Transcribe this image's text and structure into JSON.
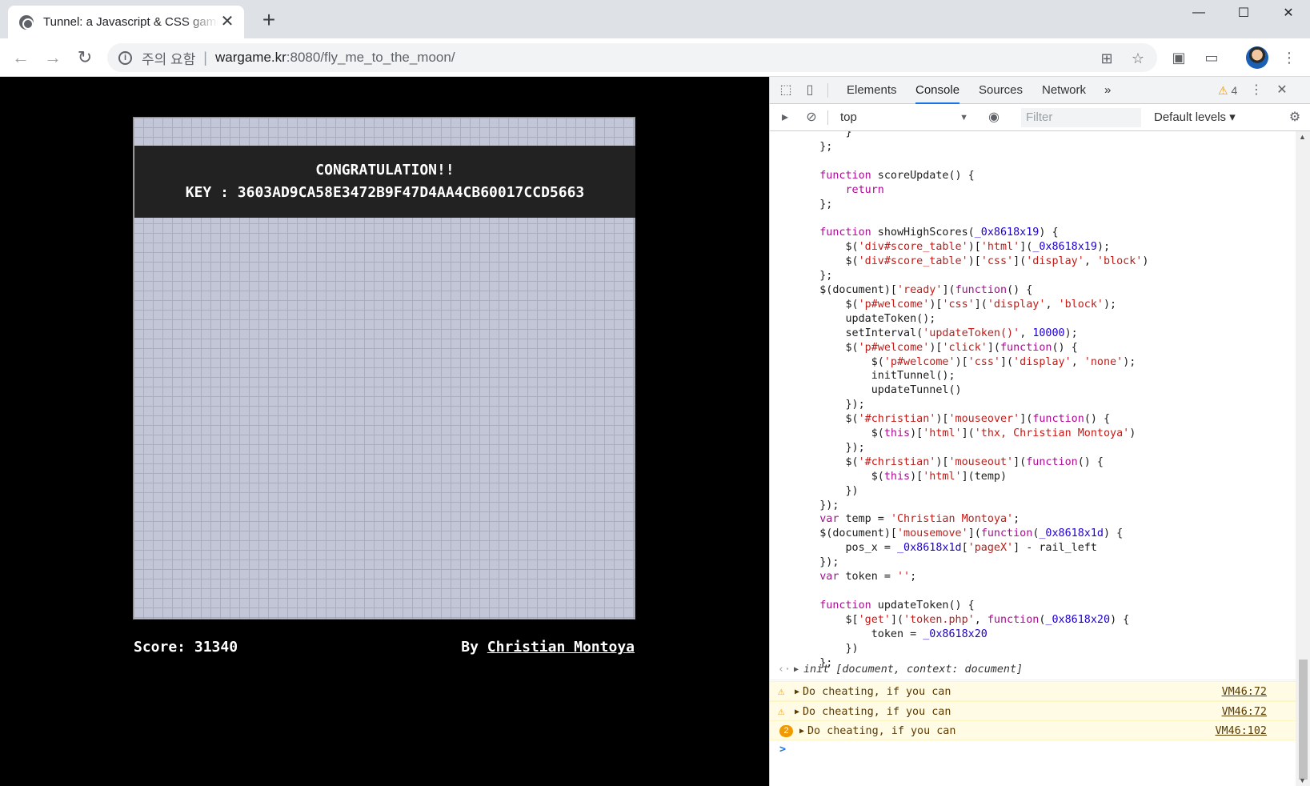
{
  "browser": {
    "tab_title": "Tunnel: a Javascript & CSS game",
    "tab_close": "✕",
    "new_tab": "+",
    "window_controls": {
      "minimize": "—",
      "maximize": "☐",
      "close": "✕"
    },
    "security_label": "주의 요함",
    "url_host": "wargame.kr",
    "url_path": ":8080/fly_me_to_the_moon/",
    "icons": [
      "back-icon",
      "forward-icon",
      "reload-icon",
      "info-icon",
      "translate-icon",
      "star-icon",
      "extension-icon",
      "cast-icon",
      "avatar",
      "menu-icon"
    ]
  },
  "game": {
    "congrats": "CONGRATULATION!!",
    "key_line": "KEY : 3603AD9CA58E3472B9F47D4AA4CB60017CCD5663",
    "score_label": "Score: 31340",
    "by_label": "By",
    "author": "Christian Montoya"
  },
  "devtools": {
    "tabs": [
      "Elements",
      "Console",
      "Sources",
      "Network"
    ],
    "active_tab": "Console",
    "more_tabs": "»",
    "warning_count": "4",
    "context": "top",
    "filter_placeholder": "Filter",
    "levels": "Default levels ▾",
    "code_lines": [
      "        }",
      "    };",
      "",
      "    function scoreUpdate() {",
      "        return",
      "    };",
      "",
      "    function showHighScores(_0x8618x19) {",
      "        $('div#score_table')['html'](_0x8618x19);",
      "        $('div#score_table')['css']('display', 'block')",
      "    };",
      "    $(document)['ready'](function() {",
      "        $('p#welcome')['css']('display', 'block');",
      "        updateToken();",
      "        setInterval('updateToken()', 10000);",
      "        $('p#welcome')['click'](function() {",
      "            $('p#welcome')['css']('display', 'none');",
      "            initTunnel();",
      "            updateTunnel()",
      "        });",
      "        $('#christian')['mouseover'](function() {",
      "            $(this)['html']('thx, Christian Montoya')",
      "        });",
      "        $('#christian')['mouseout'](function() {",
      "            $(this)['html'](temp)",
      "        })",
      "    });",
      "    var temp = 'Christian Montoya';",
      "    $(document)['mousemove'](function(_0x8618x1d) {",
      "        pos_x = _0x8618x1d['pageX'] - rail_left",
      "    });",
      "    var token = '';",
      "",
      "    function updateToken() {",
      "        $['get']('token.php', function(_0x8618x20) {",
      "            token = _0x8618x20",
      "        })",
      "    };"
    ],
    "result": "init [document, context: document]",
    "warnings": [
      {
        "message": "Do cheating, if you can",
        "source": "VM46:72",
        "count": ""
      },
      {
        "message": "Do cheating, if you can",
        "source": "VM46:72",
        "count": ""
      },
      {
        "message": "Do cheating, if you can",
        "source": "VM46:102",
        "count": "2"
      }
    ],
    "prompt": ">"
  }
}
